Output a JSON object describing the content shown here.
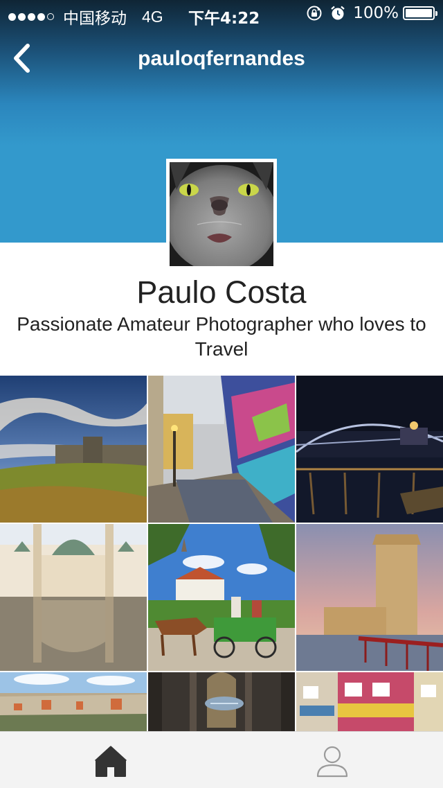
{
  "status_bar": {
    "signal_dots": 5,
    "signal_filled": 4,
    "carrier": "中国移动",
    "network": "4G",
    "time": "下午4:22",
    "battery_percent": "100%",
    "battery_level": 1.0,
    "icons": [
      "rotation-lock-icon",
      "alarm-icon"
    ]
  },
  "nav": {
    "title": "pauloqfernandes",
    "back_icon": "chevron-left-icon"
  },
  "profile": {
    "name": "Paulo Costa",
    "bio": "Passionate Amateur Photographer who loves to Travel",
    "avatar": "cat-face-photo"
  },
  "photos": [
    {
      "subject": "castle-ruins-on-hill-under-dramatic-sky"
    },
    {
      "subject": "colorful-graffiti-stairway-street"
    },
    {
      "subject": "night-bridge-over-river"
    },
    {
      "subject": "baroque-church-reflected-in-pond"
    },
    {
      "subject": "horse-carriage-in-town-square"
    },
    {
      "subject": "stone-tower-at-sunset-with-pier"
    },
    {
      "subject": "city-panorama"
    },
    {
      "subject": "cathedral-interior-hanging-sculpture"
    },
    {
      "subject": "colorful-facade-building"
    }
  ],
  "tab_bar": {
    "tabs": [
      {
        "icon": "home-icon",
        "selected": true
      },
      {
        "icon": "profile-icon",
        "selected": false
      }
    ]
  },
  "colors": {
    "header_blue": "#3399cc",
    "header_dark": "#0f2535",
    "text_dark": "#222222",
    "tab_selected": "#333333",
    "tab_unselected": "#9a9a9a"
  }
}
